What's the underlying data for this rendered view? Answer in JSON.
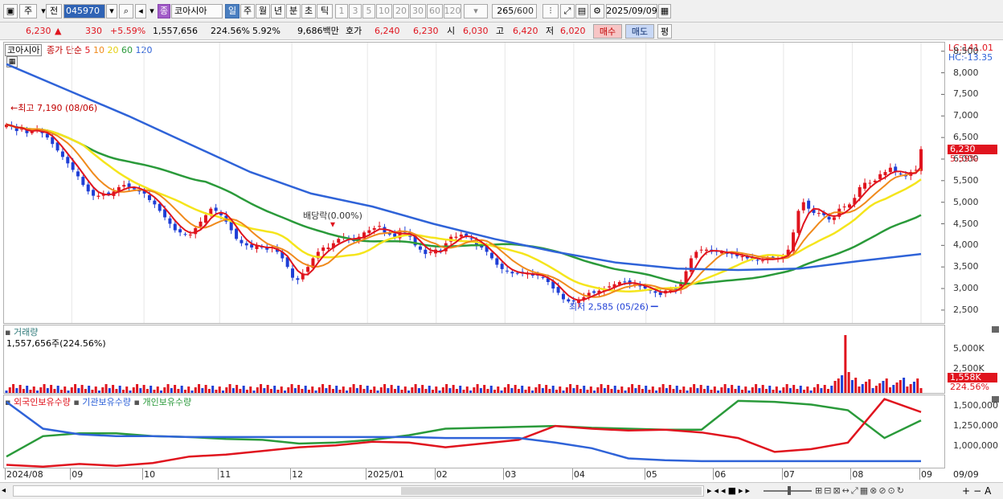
{
  "toolbar": {
    "market_mode": "주",
    "market_filter": "전",
    "stock_code": "045970",
    "stock_badge": "종",
    "stock_name": "코아시아",
    "periods": [
      "일",
      "주",
      "월",
      "년",
      "분",
      "초",
      "틱"
    ],
    "selected_period": "일",
    "intervals": [
      "1",
      "3",
      "5",
      "10",
      "20",
      "30",
      "60",
      "120"
    ],
    "count_current": "265",
    "count_total": "/600",
    "date": "2025/09/09"
  },
  "quote": {
    "price": "6,230",
    "change_arrow": "▲",
    "change": "330",
    "change_pct": "+5.59%",
    "volume": "1,557,656",
    "volume_pct": "224.56%",
    "turnover_pct": "5.92%",
    "amount": "9,686백만",
    "ask_label": "호가",
    "ask": "6,240",
    "bid": "6,230",
    "open_label": "시",
    "open": "6,030",
    "high_label": "고",
    "high": "6,420",
    "low_label": "저",
    "low": "6,020",
    "buy_button": "매수",
    "sell_button": "매도",
    "eval_button": "평"
  },
  "colors": {
    "up": "#e0141e",
    "down": "#1f3fd6",
    "ma5": "#e0141e",
    "ma10": "#f08a1c",
    "ma20": "#f5e51c",
    "ma60": "#2a9a3a",
    "ma120": "#2f63d8",
    "foreign": "#e0141e",
    "institution": "#2f63d8",
    "individual": "#2a9a3a"
  },
  "chart_data": [
    {
      "type": "candlestick",
      "name": "price",
      "legend": {
        "stock": "코아시아",
        "ma_label": "종가 단순",
        "ma_periods": [
          "5",
          "10",
          "20",
          "60",
          "120"
        ]
      },
      "lc_label": "LC:141.01",
      "hc_label": "HC:-13.35",
      "ylim": [
        2200,
        8700
      ],
      "yticks": [
        "8,500",
        "8,000",
        "7,500",
        "7,000",
        "6,500",
        "6,000",
        "5,500",
        "5,000",
        "4,500",
        "4,000",
        "3,500",
        "3,000",
        "2,500"
      ],
      "last_price_tag": "6,230",
      "last_pct_tag": "5.59%",
      "annotations": {
        "high": "최고 7,190 (08/06)",
        "low": "최저 2,585 (05/26)",
        "dividend": "배당락(0.00%)"
      },
      "close_series": [
        6800,
        6750,
        6650,
        6700,
        6600,
        6650,
        6700,
        6600,
        6500,
        6350,
        6200,
        6050,
        5900,
        5750,
        5600,
        5400,
        5250,
        5150,
        5150,
        5200,
        5180,
        5250,
        5350,
        5400,
        5350,
        5300,
        5250,
        5200,
        5050,
        4950,
        4800,
        4650,
        4500,
        4350,
        4300,
        4250,
        4250,
        4400,
        4550,
        4700,
        4850,
        4800,
        4700,
        4550,
        4350,
        4150,
        4050,
        4000,
        3950,
        4000,
        3950,
        3900,
        3950,
        3850,
        3700,
        3500,
        3250,
        3200,
        3350,
        3500,
        3700,
        3850,
        3950,
        3950,
        4050,
        4150,
        4200,
        4150,
        4100,
        4200,
        4300,
        4350,
        4400,
        4450,
        4300,
        4250,
        4200,
        4350,
        4300,
        4200,
        4000,
        3900,
        3800,
        3850,
        3900,
        3850,
        4050,
        4200,
        4200,
        4250,
        4200,
        4150,
        4000,
        3950,
        3850,
        3700,
        3550,
        3450,
        3400,
        3350,
        3350,
        3350,
        3350,
        3300,
        3300,
        3250,
        3150,
        3000,
        2900,
        2750,
        2700,
        2700,
        2750,
        2800,
        2900,
        2900,
        2950,
        3000,
        3050,
        3100,
        3150,
        3150,
        3100,
        3100,
        3050,
        3000,
        2950,
        2900,
        2850,
        2950,
        3000,
        2950,
        3150,
        3400,
        3700,
        3850,
        3900,
        3900,
        3850,
        3850,
        3850,
        3800,
        3800,
        3750,
        3750,
        3700,
        3700,
        3650,
        3650,
        3700,
        3700,
        3700,
        3750,
        3900,
        4300,
        4800,
        5000,
        4850,
        4750,
        4750,
        4700,
        4600,
        4650,
        4850,
        4900,
        4950,
        5100,
        5350,
        5450,
        5450,
        5500,
        5650,
        5700,
        5800,
        5700,
        5650,
        5600,
        5700,
        5750,
        6230
      ],
      "ma120_series": [
        8200,
        7600,
        7000,
        6350,
        5700,
        5200,
        4900,
        4500,
        4150,
        3850,
        3600,
        3460,
        3430,
        3460,
        3640,
        3800
      ]
    },
    {
      "type": "bar",
      "name": "volume",
      "title": "거래량",
      "value_label": "1,557,656주(224.56%)",
      "yticks": [
        "5,000K",
        "2,500K"
      ],
      "last_tag": "1,558K",
      "last_pct_tag": "224.56%"
    },
    {
      "type": "line",
      "name": "holdings",
      "legend": [
        "외국인보유수량",
        "기관보유수량",
        "개인보유수량"
      ],
      "yticks": [
        "1,500,000",
        "1,250,000",
        "1,000,000"
      ],
      "foreign_series": [
        810,
        790,
        820,
        800,
        830,
        900,
        920,
        960,
        1000,
        1020,
        1060,
        1050,
        1000,
        1040,
        1080,
        1230,
        1200,
        1180,
        1190,
        1160,
        1100,
        950,
        980,
        1050,
        1520,
        1380
      ],
      "institution_series": [
        1490,
        1200,
        1140,
        1120,
        1120,
        1110,
        1110,
        1110,
        1110,
        1110,
        1110,
        1110,
        1100,
        1100,
        1100,
        1050,
        990,
        880,
        860,
        850,
        850,
        850,
        850,
        850,
        850,
        850
      ],
      "individual_series": [
        900,
        1120,
        1150,
        1150,
        1120,
        1110,
        1090,
        1080,
        1040,
        1050,
        1080,
        1130,
        1200,
        1210,
        1220,
        1230,
        1210,
        1200,
        1190,
        1190,
        1500,
        1490,
        1460,
        1400,
        1100,
        1290
      ]
    }
  ],
  "xaxis_labels": [
    "2024/08",
    "09",
    "10",
    "11",
    "12",
    "2025/01",
    "02",
    "03",
    "04",
    "05",
    "06",
    "07",
    "08",
    "09"
  ],
  "xaxis_last_date": "09/09"
}
